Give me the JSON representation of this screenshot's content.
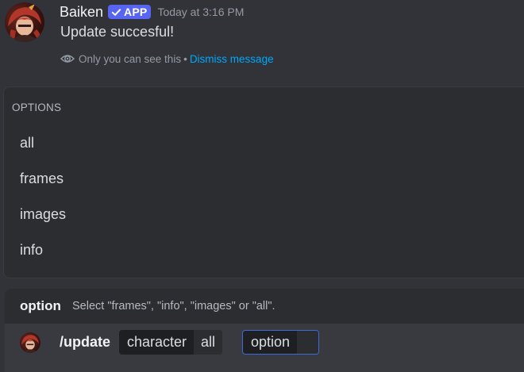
{
  "message": {
    "username": "Baiken",
    "badge": "APP",
    "timestamp": "Today at 3:16 PM",
    "body": "Update succesful!",
    "ephemeral_text": "Only you can see this",
    "separator": "•",
    "dismiss_link": "Dismiss message"
  },
  "options_popup": {
    "header": "OPTIONS",
    "items": [
      "all",
      "frames",
      "images",
      "info"
    ]
  },
  "hint": {
    "name": "option",
    "description": "Select \"frames\", \"info\", \"images\" or \"all\"."
  },
  "command": {
    "name": "/update",
    "params": [
      {
        "label": "character",
        "value": "all"
      },
      {
        "label": "option",
        "value": ""
      }
    ]
  },
  "colors": {
    "background": "#313338",
    "app_badge": "#5865f2",
    "link": "#00a8fc",
    "focus_border": "#3e6ad8"
  }
}
